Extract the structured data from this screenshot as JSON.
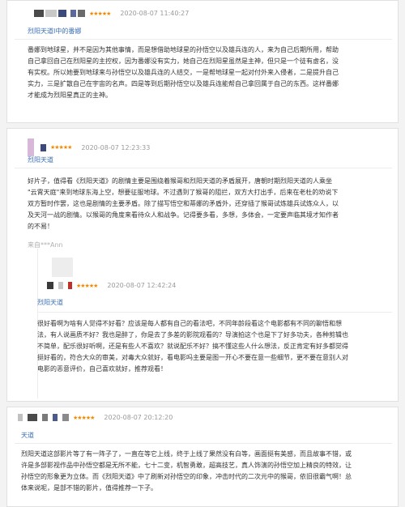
{
  "reviews": [
    {
      "stars": "★★★★★",
      "date": "2020-08-07 11:40:27",
      "title": "烈阳天道Ⅰ中的番娜",
      "lines": [
        "番娜到地球星，并不是因为其他事情，而是想借助地球星的孙悟空以及雄兵连的人，来为自己后期所用，帮助",
        "自己拿回自己在烈阳星的主控权，因为番娜没有实力，她自己在烈阳星虽然是主神，但只是一个徒有虚名，没",
        "有实权。所以她要到地球来与孙悟空以及雄兵连的人结交，一是帮地球星一起对付外来入侵者，二是提升自己",
        "实力，三是扩散自己在宇宙的名声。四是等到后期孙悟空以及雄兵连能帮自己拿回属于自己的东西。这样番娜",
        "才能成为烈阳星真正的主神。"
      ]
    },
    {
      "stars": "★★★★★",
      "date": "2020-08-07 12:23:33",
      "title": "烈阳天道",
      "lines": [
        "好片子，值得看《烈阳天道》的剧情主要是围绕着猴哥和烈阳天道的矛盾展开，唐朝时期烈阳天道的人乘坐",
        "\"云霄天庭\"来到地球东海上空，想要征服地球。不过遇到了猴哥的阻拦，双方大打出手，后来在老杜的劝说下",
        "双方暂时作罢，这也是剧情的主要矛盾。除了描写悟空和蒂娜的矛盾外，还穿插了猴哥试炼雄兵试炼众人，以",
        "及天河一战的剧情。以猴哥的角度来看待众人和战争。记得要多看，多想，多体会，一定要声临其境才知作者",
        "的不易！"
      ],
      "reply_user": "来自***Ann",
      "reply": {
        "stars": "★★★★★",
        "date": "2020-08-07 12:42:24",
        "title": "烈阳天道",
        "lines": [
          "很好看啊为啥有人觉得不好看？应该是每人都有自己的看法吧，不同年龄段看这个电影都有不同的聊悟和想",
          "法，有人说画质不好？我也是醉了，你是去了多差的影院观看的？导演拍这个也是下了好多功夫，各种剪辑也",
          "不简单，配乐很好听啊，还是有些人不喜欢？就说配乐不好？搞不懂这些人什么想法，反正肯定有好多都觉得",
          "挺好看的，符合大众的审美，对毒大众就好，看电影吗主要是图一开心不要在意一些细节，更不要在意别人对",
          "电影的恶意评价，自己喜欢就好，推荐观看！"
        ]
      }
    },
    {
      "stars": "★★★★★",
      "date": "2020-08-07 20:12:20",
      "title": "天道",
      "lines": [
        "烈阳天道这部影片等了有一阵子了，一直在等它上线，终于上线了果然没有白等，画面挺有美感，而且故事不错，或",
        "许是多部影视作品中孙悟空都是无所不能，七十二变，机智勇敢，超高技艺，真人饰演的孙悟空加上精良的特效，让",
        "孙悟空的形象更为立体。而《烈阳天道》中了刷新对孙悟空的印象，冲击时代的二次元中的猴哥，依旧很霸气啊！总",
        "体来说呢，是部不错的影片，值得推荐一下子。"
      ]
    }
  ]
}
